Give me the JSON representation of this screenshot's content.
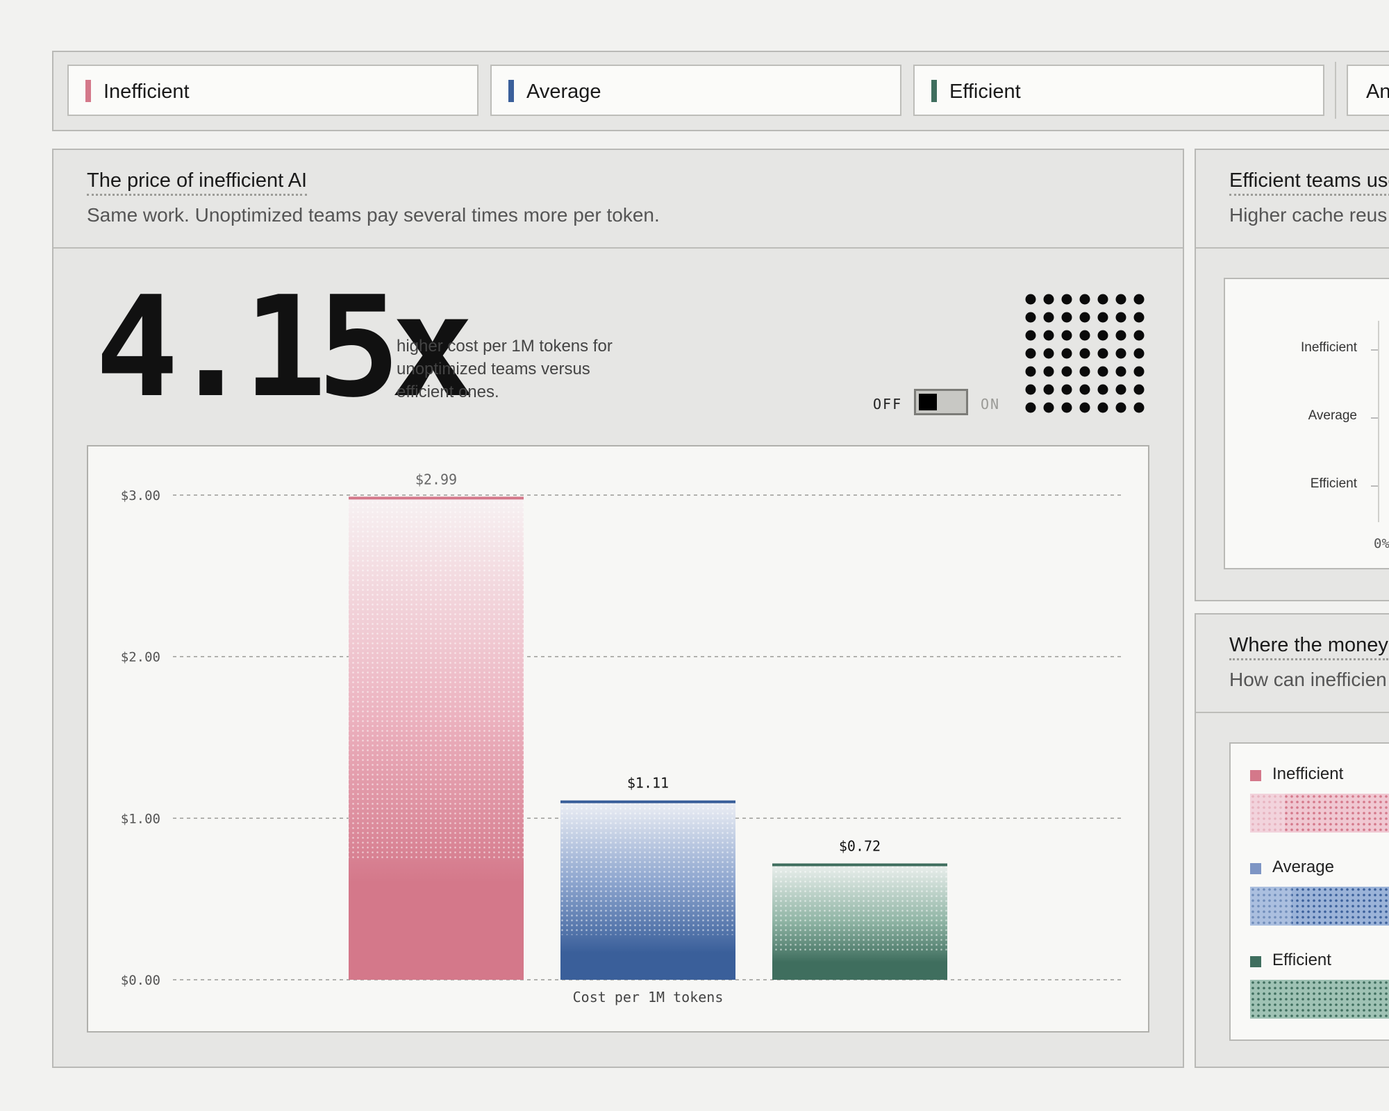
{
  "legend": {
    "items": [
      {
        "label": "Inefficient",
        "color": "#d4788a"
      },
      {
        "label": "Average",
        "color": "#3a5f9a"
      },
      {
        "label": "Efficient",
        "color": "#3f6e5e"
      }
    ],
    "overflow_label": "An"
  },
  "main_card": {
    "title": "The price of inefficient AI",
    "subtitle": "Same work. Unoptimized teams pay several times more per token.",
    "stat_value": "4.15x",
    "stat_description": "higher cost per 1M tokens for unoptimized teams versus efficient ones.",
    "toggle": {
      "off_label": "OFF",
      "on_label": "ON",
      "state": "off"
    }
  },
  "chart_data": {
    "type": "bar",
    "categories": [
      "Inefficient",
      "Average",
      "Efficient"
    ],
    "values": [
      2.99,
      1.11,
      0.72
    ],
    "value_labels": [
      "$2.99",
      "$1.11",
      "$0.72"
    ],
    "colors": [
      "#d4788a",
      "#3a5f9a",
      "#3f6e5e"
    ],
    "xlabel": "Cost per 1M tokens",
    "ylabel": "",
    "ylim": [
      0,
      3
    ],
    "yticks": [
      0,
      1,
      2,
      3
    ],
    "ytick_labels": [
      "$0.00",
      "$1.00",
      "$2.00",
      "$3.00"
    ],
    "grid": true
  },
  "side_top": {
    "title": "Efficient teams use",
    "subtitle": "Higher cache reus",
    "categories": [
      "Inefficient",
      "Average",
      "Efficient"
    ],
    "axis_start_label": "0%"
  },
  "side_bottom": {
    "title": "Where the money",
    "subtitle": "How can inefficien",
    "items": [
      {
        "label": "Inefficient",
        "color": "#d4788a"
      },
      {
        "label": "Average",
        "color": "#3a5f9a"
      },
      {
        "label": "Efficient",
        "color": "#3f6e5e"
      }
    ]
  }
}
